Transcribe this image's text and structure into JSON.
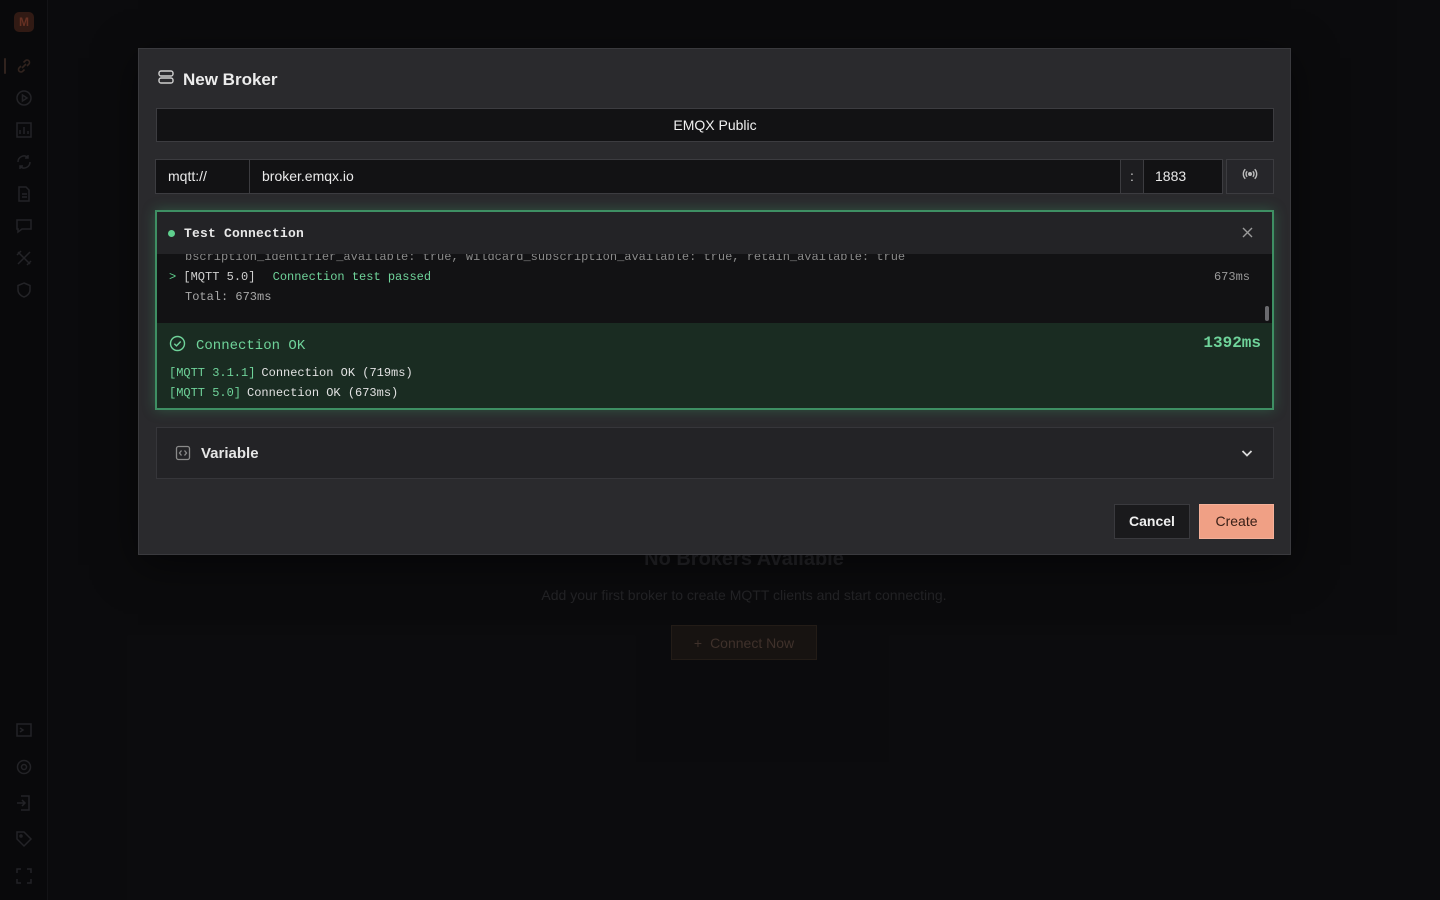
{
  "sidebar": {
    "logo": "M",
    "icons": [
      "link-icon",
      "play-icon",
      "chart-icon",
      "refresh-icon",
      "file-icon",
      "message-icon",
      "tools-icon",
      "shield-icon",
      "terminal-icon",
      "settings-icon",
      "export-icon",
      "tag-icon",
      "fullscreen-icon"
    ]
  },
  "background": {
    "empty_title": "No Brokers Available",
    "empty_subtitle": "Add your first broker to create MQTT clients and start connecting.",
    "connect_button": "Connect Now"
  },
  "dialog": {
    "title": "New Broker",
    "broker_name": "EMQX Public",
    "protocol": "mqtt://",
    "host": "broker.emqx.io",
    "port_separator": ":",
    "port": "1883",
    "test_connection": {
      "title": "Test Connection",
      "log_cut": "bscription_identifier_available: true, wildcard_subscription_available: true, retain_available: true",
      "log_arrow": ">",
      "log_tag": "[MQTT 5.0]",
      "log_message": "Connection test passed",
      "log_time": "673ms",
      "log_total": "Total: 673ms",
      "result_title": "Connection OK",
      "result_total": "1392ms",
      "results": [
        {
          "tag": "[MQTT 3.1.1]",
          "text": "Connection OK (719ms)"
        },
        {
          "tag": "[MQTT 5.0]",
          "text": "Connection OK (673ms)"
        }
      ]
    },
    "variable_label": "Variable",
    "cancel_label": "Cancel",
    "create_label": "Create"
  },
  "colors": {
    "accent": "#f0a085",
    "success": "#6fd39a",
    "panel_border": "#3e8f63"
  }
}
